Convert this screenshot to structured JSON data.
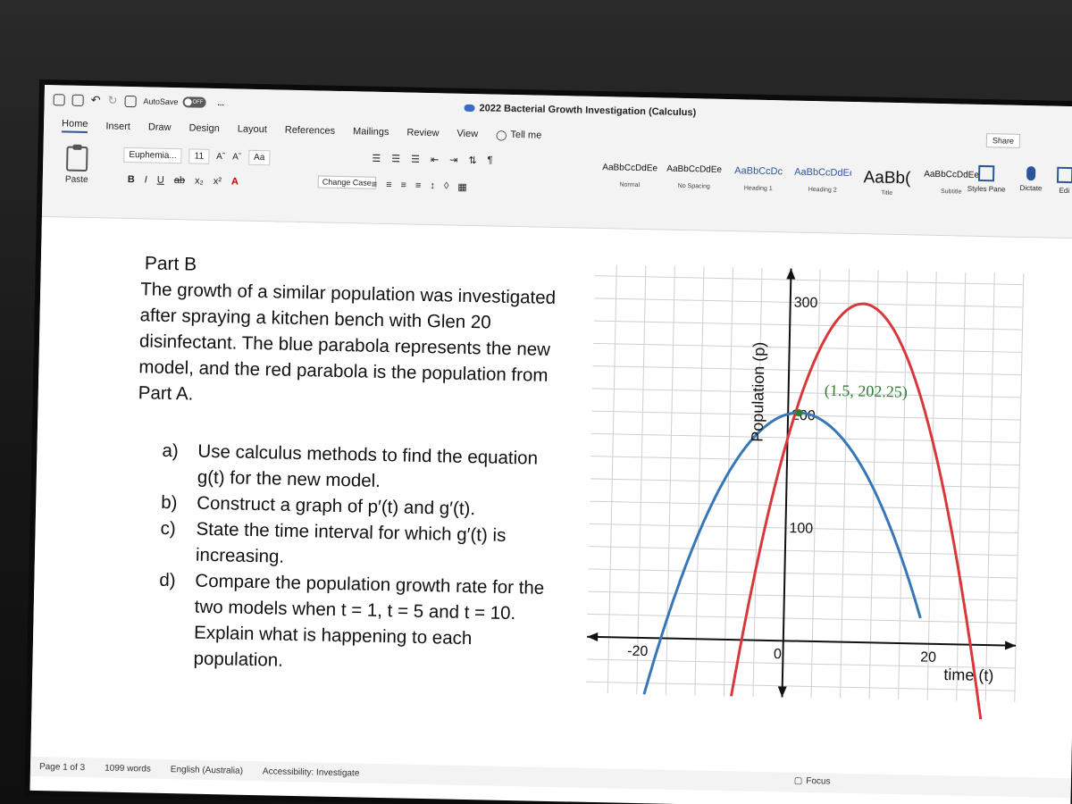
{
  "titlebar": {
    "autosave_label": "AutoSave",
    "autosave_state": "OFF",
    "more": "...",
    "doc_title": "2022 Bacterial Growth Investigation (Calculus)"
  },
  "tabs": [
    "Home",
    "Insert",
    "Draw",
    "Design",
    "Layout",
    "References",
    "Mailings",
    "Review",
    "View"
  ],
  "tell_me": "Tell me",
  "ribbon": {
    "paste": "Paste",
    "font_name": "Euphemia...",
    "font_size": "11",
    "grow_font": "Aˆ",
    "shrink_font": "Aˇ",
    "change_case_label": "Aa",
    "change_case_tooltip": "Change Case",
    "bold": "B",
    "italic": "I",
    "underline": "U",
    "strike": "ab",
    "subscript": "x₂",
    "superscript": "x²",
    "font_color": "A",
    "styles": [
      {
        "preview": "AaBbCcDdEe",
        "label": "Normal"
      },
      {
        "preview": "AaBbCcDdEe",
        "label": "No Spacing"
      },
      {
        "preview": "AaBbCcDc",
        "label": "Heading 1"
      },
      {
        "preview": "AaBbCcDdEe",
        "label": "Heading 2"
      },
      {
        "preview": "AaBb(",
        "label": "Title"
      },
      {
        "preview": "AaBbCcDdEe",
        "label": "Subtitle"
      }
    ],
    "styles_pane": "Styles Pane",
    "dictate": "Dictate",
    "editor": "Edi",
    "share": "Share"
  },
  "document": {
    "part_title": "Part B",
    "intro": "The growth of a similar population was investigated after spraying a kitchen bench with Glen 20 disinfectant. The blue parabola represents the new model, and the red parabola is the population from Part A.",
    "questions": [
      {
        "letter": "a)",
        "text": "Use calculus methods to find the equation g(t) for the new model."
      },
      {
        "letter": "b)",
        "text": "Construct a graph of p′(t) and g′(t)."
      },
      {
        "letter": "c)",
        "text": "State the time interval for which g′(t) is increasing."
      },
      {
        "letter": "d)",
        "text": "Compare the population growth rate for the two models when t = 1, t = 5 and t = 10. Explain what is happening to each population."
      }
    ]
  },
  "chart_data": {
    "type": "line",
    "xlabel": "time (t)",
    "ylabel": "Population (p)",
    "x_ticks": [
      -20,
      0,
      20
    ],
    "y_ticks": [
      100,
      200,
      300
    ],
    "xlim": [
      -27,
      32
    ],
    "ylim": [
      -50,
      330
    ],
    "grid": true,
    "series": [
      {
        "color": "#d9383a",
        "vertex": [
          10,
          300
        ],
        "points": [
          [
            -7,
            -50
          ],
          [
            0,
            200
          ],
          [
            10,
            300
          ],
          [
            20,
            200
          ],
          [
            28.3,
            -50
          ]
        ]
      },
      {
        "color": "#3777b8",
        "vertex": [
          1.5,
          202.25
        ],
        "points": [
          [
            -19,
            -50
          ],
          [
            -13,
            0
          ],
          [
            0,
            200
          ],
          [
            1.5,
            202.25
          ],
          [
            16,
            0
          ],
          [
            18.8,
            -50
          ]
        ]
      }
    ],
    "annotations": [
      {
        "text": "(1.5, 202.25)",
        "x": 1.5,
        "y": 202.25,
        "color": "#2e7d32"
      }
    ]
  },
  "status": {
    "page": "Page 1 of 3",
    "words": "1099 words",
    "language": "English (Australia)",
    "accessibility": "Accessibility: Investigate",
    "focus": "Focus"
  }
}
